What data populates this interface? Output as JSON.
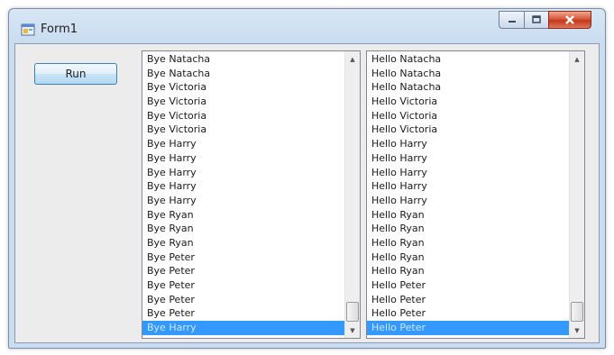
{
  "window": {
    "title": "Form1",
    "controls": {
      "minimize": "minimize",
      "maximize": "maximize",
      "close": "close"
    }
  },
  "toolbar": {
    "run_label": "Run"
  },
  "left_list": {
    "items": [
      "Bye Natacha",
      "Bye Natacha",
      "Bye Victoria",
      "Bye Victoria",
      "Bye Victoria",
      "Bye Victoria",
      "Bye Harry",
      "Bye Harry",
      "Bye Harry",
      "Bye Harry",
      "Bye Harry",
      "Bye Ryan",
      "Bye Ryan",
      "Bye Ryan",
      "Bye Peter",
      "Bye Peter",
      "Bye Peter",
      "Bye Peter",
      "Bye Peter",
      "Bye Harry"
    ],
    "selected_index": 19
  },
  "right_list": {
    "items": [
      "Hello Natacha",
      "Hello Natacha",
      "Hello Natacha",
      "Hello Victoria",
      "Hello Victoria",
      "Hello Victoria",
      "Hello Harry",
      "Hello Harry",
      "Hello Harry",
      "Hello Harry",
      "Hello Harry",
      "Hello Ryan",
      "Hello Ryan",
      "Hello Ryan",
      "Hello Ryan",
      "Hello Ryan",
      "Hello Peter",
      "Hello Peter",
      "Hello Peter",
      "Hello Peter"
    ],
    "selected_index": 19
  },
  "colors": {
    "selection": "#3399ff",
    "close_button": "#c2381c",
    "button_border": "#3c7fb1"
  },
  "icons": {
    "app": "form-app-icon",
    "scroll_up": "scroll-up-arrow-icon",
    "scroll_down": "scroll-down-arrow-icon"
  }
}
